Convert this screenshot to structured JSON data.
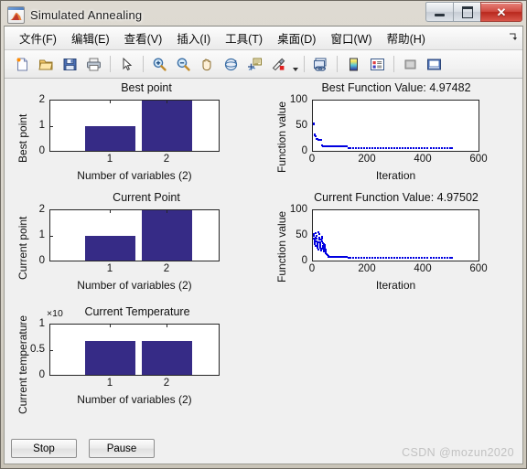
{
  "window": {
    "title": "Simulated Annealing",
    "app_icon": "matlab-icon",
    "controls": {
      "minimize": "minimize-button",
      "maximize": "maximize-button",
      "close_label": "✕"
    }
  },
  "menubar": {
    "items": [
      {
        "label": "文件(F)",
        "name": "menu-file"
      },
      {
        "label": "编辑(E)",
        "name": "menu-edit"
      },
      {
        "label": "查看(V)",
        "name": "menu-view"
      },
      {
        "label": "插入(I)",
        "name": "menu-insert"
      },
      {
        "label": "工具(T)",
        "name": "menu-tools"
      },
      {
        "label": "桌面(D)",
        "name": "menu-desktop"
      },
      {
        "label": "窗口(W)",
        "name": "menu-window"
      },
      {
        "label": "帮助(H)",
        "name": "menu-help"
      }
    ],
    "overflow_glyph": "❥"
  },
  "toolbar": {
    "buttons": [
      {
        "name": "new-figure-icon",
        "title": "New Figure"
      },
      {
        "name": "open-file-icon",
        "title": "Open File"
      },
      {
        "name": "save-figure-icon",
        "title": "Save Figure"
      },
      {
        "name": "print-figure-icon",
        "title": "Print Figure"
      },
      {
        "name": "pointer-select-icon",
        "title": "Edit Plot"
      },
      {
        "name": "zoom-in-icon",
        "title": "Zoom In"
      },
      {
        "name": "zoom-out-icon",
        "title": "Zoom Out"
      },
      {
        "name": "pan-hand-icon",
        "title": "Pan"
      },
      {
        "name": "rotate-3d-icon",
        "title": "Rotate 3D"
      },
      {
        "name": "data-cursor-icon",
        "title": "Data Cursor"
      },
      {
        "name": "brush-icon",
        "title": "Brush/Select Data"
      },
      {
        "name": "link-plot-icon",
        "title": "Link Plot"
      },
      {
        "name": "colorbar-icon",
        "title": "Insert Colorbar"
      },
      {
        "name": "legend-icon",
        "title": "Insert Legend"
      },
      {
        "name": "hide-plot-tools-icon",
        "title": "Hide Plot Tools"
      },
      {
        "name": "show-plot-tools-icon",
        "title": "Show Plot Tools"
      }
    ]
  },
  "controls": {
    "stop_label": "Stop",
    "pause_label": "Pause"
  },
  "watermark": "CSDN @mozun2020",
  "colors": {
    "bar_fill": "#362b86",
    "marker": "#0000e0",
    "axes_bg": "#ffffff",
    "figure_bg": "#f0f0f0"
  },
  "chart_data": [
    {
      "type": "bar",
      "name": "best-point-chart",
      "title": "Best point",
      "xlabel": "Number of variables (2)",
      "ylabel": "Best point",
      "categories": [
        "1",
        "2"
      ],
      "values": [
        1,
        2
      ],
      "yticks": [
        "0",
        "1",
        "2"
      ],
      "ylim": [
        0,
        2
      ],
      "grid": false,
      "legend": false
    },
    {
      "type": "scatter",
      "name": "best-function-value-chart",
      "title": "Best Function Value: 4.97482",
      "xlabel": "Iteration",
      "ylabel": "Function value",
      "xticks": [
        "0",
        "200",
        "400",
        "600"
      ],
      "yticks": [
        "0",
        "50",
        "100"
      ],
      "xlim": [
        0,
        600
      ],
      "ylim": [
        0,
        100
      ],
      "grid": false,
      "legend": false,
      "points": [
        [
          2,
          55
        ],
        [
          4,
          52
        ],
        [
          6,
          33
        ],
        [
          8,
          31
        ],
        [
          10,
          30
        ],
        [
          13,
          24
        ],
        [
          16,
          23
        ],
        [
          19,
          22
        ],
        [
          22,
          22
        ],
        [
          25,
          22
        ],
        [
          28,
          22
        ],
        [
          31,
          22
        ],
        [
          34,
          11
        ],
        [
          38,
          10
        ],
        [
          42,
          10
        ],
        [
          46,
          10
        ],
        [
          50,
          10
        ],
        [
          56,
          10
        ],
        [
          62,
          10
        ],
        [
          68,
          10
        ],
        [
          74,
          10
        ],
        [
          80,
          10
        ],
        [
          86,
          10
        ],
        [
          92,
          10
        ],
        [
          98,
          10
        ],
        [
          104,
          10
        ],
        [
          110,
          10
        ],
        [
          116,
          10
        ],
        [
          122,
          9
        ],
        [
          128,
          6
        ],
        [
          136,
          6
        ],
        [
          146,
          6
        ],
        [
          156,
          6
        ],
        [
          166,
          6
        ],
        [
          176,
          6
        ],
        [
          186,
          6
        ],
        [
          196,
          6
        ],
        [
          206,
          6
        ],
        [
          216,
          6
        ],
        [
          226,
          6
        ],
        [
          236,
          6
        ],
        [
          246,
          6
        ],
        [
          256,
          6
        ],
        [
          266,
          6
        ],
        [
          276,
          6
        ],
        [
          286,
          6
        ],
        [
          296,
          6
        ],
        [
          306,
          6
        ],
        [
          316,
          6
        ],
        [
          326,
          6
        ],
        [
          336,
          6
        ],
        [
          346,
          6
        ],
        [
          356,
          6
        ],
        [
          366,
          6
        ],
        [
          376,
          6
        ],
        [
          386,
          6
        ],
        [
          396,
          6
        ],
        [
          406,
          6
        ],
        [
          416,
          6
        ],
        [
          426,
          6
        ],
        [
          436,
          6
        ],
        [
          446,
          6
        ],
        [
          456,
          6
        ],
        [
          466,
          6
        ],
        [
          476,
          6
        ],
        [
          486,
          6
        ],
        [
          496,
          5
        ],
        [
          505,
          5
        ]
      ]
    },
    {
      "type": "bar",
      "name": "current-point-chart",
      "title": "Current Point",
      "xlabel": "Number of variables (2)",
      "ylabel": "Current point",
      "categories": [
        "1",
        "2"
      ],
      "values": [
        1,
        2
      ],
      "yticks": [
        "0",
        "1",
        "2"
      ],
      "ylim": [
        0,
        2
      ],
      "grid": false,
      "legend": false
    },
    {
      "type": "scatter",
      "name": "current-function-value-chart",
      "title": "Current Function Value: 4.97502",
      "xlabel": "Iteration",
      "ylabel": "Function value",
      "xticks": [
        "0",
        "200",
        "400",
        "600"
      ],
      "yticks": [
        "0",
        "50",
        "100"
      ],
      "xlim": [
        0,
        600
      ],
      "ylim": [
        0,
        100
      ],
      "grid": false,
      "legend": false,
      "points": [
        [
          2,
          53
        ],
        [
          3,
          49
        ],
        [
          4,
          44
        ],
        [
          5,
          41
        ],
        [
          6,
          38
        ],
        [
          7,
          36
        ],
        [
          8,
          33
        ],
        [
          9,
          30
        ],
        [
          10,
          46
        ],
        [
          11,
          55
        ],
        [
          12,
          50
        ],
        [
          13,
          43
        ],
        [
          14,
          39
        ],
        [
          15,
          35
        ],
        [
          16,
          31
        ],
        [
          17,
          28
        ],
        [
          18,
          25
        ],
        [
          19,
          22
        ],
        [
          20,
          36
        ],
        [
          21,
          57
        ],
        [
          22,
          52
        ],
        [
          23,
          46
        ],
        [
          24,
          41
        ],
        [
          25,
          37
        ],
        [
          26,
          33
        ],
        [
          27,
          29
        ],
        [
          28,
          26
        ],
        [
          29,
          23
        ],
        [
          30,
          20
        ],
        [
          31,
          41
        ],
        [
          32,
          48
        ],
        [
          33,
          44
        ],
        [
          34,
          39
        ],
        [
          35,
          34
        ],
        [
          36,
          30
        ],
        [
          37,
          27
        ],
        [
          38,
          24
        ],
        [
          39,
          21
        ],
        [
          40,
          18
        ],
        [
          41,
          33
        ],
        [
          42,
          31
        ],
        [
          43,
          28
        ],
        [
          44,
          25
        ],
        [
          45,
          22
        ],
        [
          46,
          19
        ],
        [
          47,
          16
        ],
        [
          48,
          15
        ],
        [
          50,
          13
        ],
        [
          52,
          11
        ],
        [
          55,
          9
        ],
        [
          58,
          8
        ],
        [
          62,
          7
        ],
        [
          66,
          7
        ],
        [
          70,
          7
        ],
        [
          75,
          7
        ],
        [
          80,
          7
        ],
        [
          86,
          7
        ],
        [
          92,
          7
        ],
        [
          98,
          7
        ],
        [
          104,
          7
        ],
        [
          110,
          7
        ],
        [
          116,
          7
        ],
        [
          122,
          7
        ],
        [
          128,
          6
        ],
        [
          136,
          6
        ],
        [
          146,
          6
        ],
        [
          156,
          6
        ],
        [
          166,
          6
        ],
        [
          176,
          6
        ],
        [
          186,
          6
        ],
        [
          196,
          6
        ],
        [
          206,
          6
        ],
        [
          216,
          6
        ],
        [
          226,
          6
        ],
        [
          236,
          6
        ],
        [
          246,
          6
        ],
        [
          256,
          6
        ],
        [
          266,
          6
        ],
        [
          276,
          6
        ],
        [
          286,
          6
        ],
        [
          296,
          6
        ],
        [
          306,
          6
        ],
        [
          316,
          6
        ],
        [
          326,
          6
        ],
        [
          336,
          6
        ],
        [
          346,
          6
        ],
        [
          356,
          6
        ],
        [
          366,
          6
        ],
        [
          376,
          6
        ],
        [
          386,
          6
        ],
        [
          396,
          6
        ],
        [
          406,
          6
        ],
        [
          416,
          6
        ],
        [
          426,
          6
        ],
        [
          436,
          6
        ],
        [
          446,
          6
        ],
        [
          456,
          6
        ],
        [
          466,
          6
        ],
        [
          476,
          6
        ],
        [
          486,
          6
        ],
        [
          496,
          5
        ],
        [
          505,
          5
        ]
      ]
    },
    {
      "type": "bar",
      "name": "current-temperature-chart",
      "title": "Current Temperature",
      "xlabel": "Number of variables (2)",
      "ylabel": "Current temperature",
      "exponent_label": "×10",
      "categories": [
        "1",
        "2"
      ],
      "values": [
        0.67,
        0.67
      ],
      "yticks": [
        "0",
        "0.5",
        "1"
      ],
      "ylim": [
        0,
        1
      ],
      "grid": false,
      "legend": false
    }
  ]
}
